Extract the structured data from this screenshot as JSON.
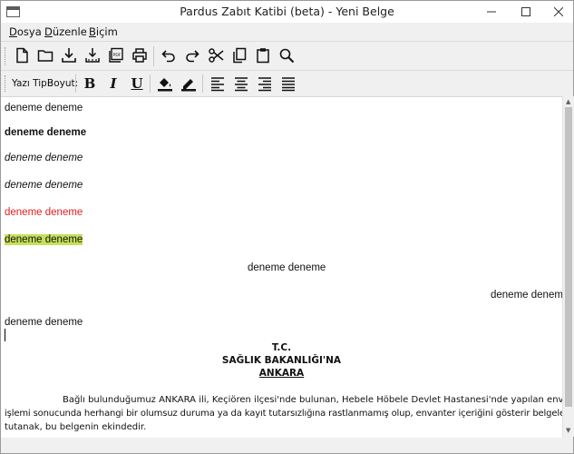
{
  "window": {
    "title": "Pardus Zabıt Katibi (beta) - Yeni Belge",
    "controls": {
      "minimize": "—",
      "maximize": "☐",
      "close": "✕"
    }
  },
  "menu": [
    "Dosya",
    "Düzenle",
    "Biçim"
  ],
  "toolbar": {
    "icons": [
      "new-document-icon",
      "open-folder-icon",
      "save-icon",
      "save-as-icon",
      "export-pdf-icon",
      "print-icon",
      "undo-icon",
      "redo-icon",
      "cut-icon",
      "copy-icon",
      "paste-icon",
      "search-icon"
    ]
  },
  "format_toolbar": {
    "font_label": "Yazı Tipi:",
    "size_label": "Boyut:",
    "bold": "B",
    "italic": "I",
    "underline": "U",
    "icons": [
      "fill-color-icon",
      "text-color-icon",
      "align-left-icon",
      "align-center-icon",
      "align-right-icon",
      "align-justify-icon"
    ],
    "colors": {
      "highlight": "#c6e05a",
      "red_text": "#e02020"
    }
  },
  "editor": {
    "lines": [
      {
        "text": "deneme deneme",
        "style": "normal"
      },
      {
        "text": "deneme deneme",
        "style": "bold"
      },
      {
        "text": "deneme deneme",
        "style": "italic"
      },
      {
        "text": "deneme deneme",
        "style": "italic"
      },
      {
        "text": "deneme deneme",
        "style": "red"
      },
      {
        "text": "deneme deneme",
        "style": "highlight"
      },
      {
        "text": "deneme deneme",
        "style": "center"
      },
      {
        "text": "deneme deneme",
        "style": "right"
      },
      {
        "text": "deneme deneme",
        "style": "normal"
      }
    ],
    "heading": {
      "line1": "T.C.",
      "line2": "SAĞLIK BAKANLIĞI'NA",
      "line3": "ANKARA"
    },
    "paragraph": {
      "line1": "Bağlı bulunduğumuz ANKARA ili, Keçiören ilçesi'nde bulunan, Hebele Höbele Devlet Hastanesi'nde yapılan envanter",
      "line2": "işlemi sonucunda herhangi bir olumsuz duruma ya da kayıt tutarsızlığına rastlanmamış olup, envanter içeriğini gösterir belgelerle ilgili",
      "line3": "tutanak, bu belgenin ekindedir."
    }
  }
}
